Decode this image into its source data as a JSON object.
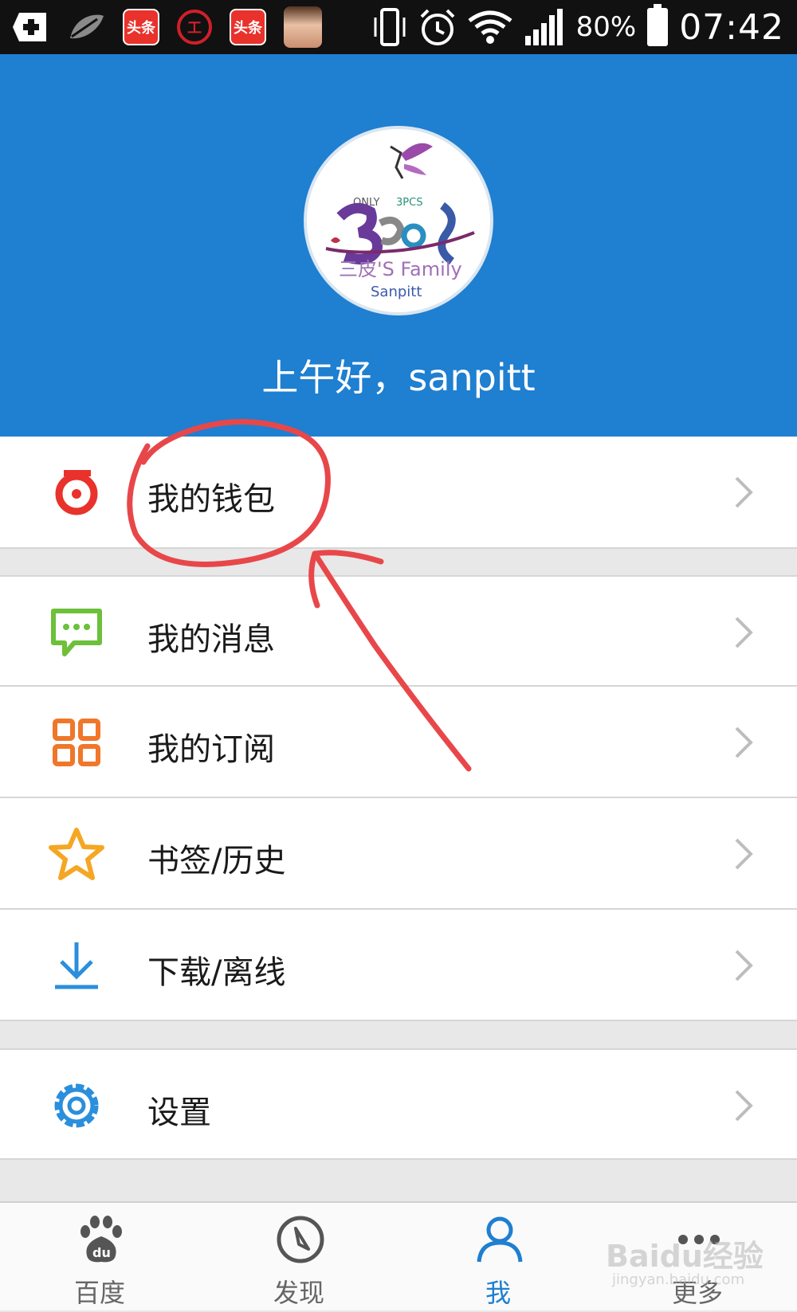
{
  "status_bar": {
    "news_app_1": "头条",
    "news_app_2": "头条",
    "bank_app": "工",
    "battery": "80%",
    "time": "07:42"
  },
  "header": {
    "avatar_text_top": "3PCS",
    "avatar_text_only": "ONLY",
    "avatar_text_main": "三皮'S Family",
    "avatar_text_sub": "Sanpitt",
    "greeting": "上午好，sanpitt",
    "background_color": "#1f7fd0"
  },
  "menu": {
    "wallet": {
      "label": "我的钱包",
      "icon": "wallet-icon",
      "color": "#e8322b"
    },
    "messages": {
      "label": "我的消息",
      "icon": "message-icon",
      "color": "#6cc03a"
    },
    "subscriptions": {
      "label": "我的订阅",
      "icon": "grid-icon",
      "color": "#f0772a"
    },
    "bookmarks": {
      "label": "书签/历史",
      "icon": "star-icon",
      "color": "#f5a623"
    },
    "downloads": {
      "label": "下载/离线",
      "icon": "download-icon",
      "color": "#2a8fdc"
    },
    "settings": {
      "label": "设置",
      "icon": "gear-icon",
      "color": "#2a8fdc"
    }
  },
  "tabs": [
    {
      "label": "百度",
      "icon": "paw-icon"
    },
    {
      "label": "发现",
      "icon": "compass-icon"
    },
    {
      "label": "我",
      "icon": "person-icon",
      "active": true
    },
    {
      "label": "更多",
      "icon": "more-dots-icon"
    }
  ],
  "watermark": {
    "text": "Baidu经验",
    "sub": "jingyan.baidu.com"
  },
  "annotation_color": "#e8474a"
}
